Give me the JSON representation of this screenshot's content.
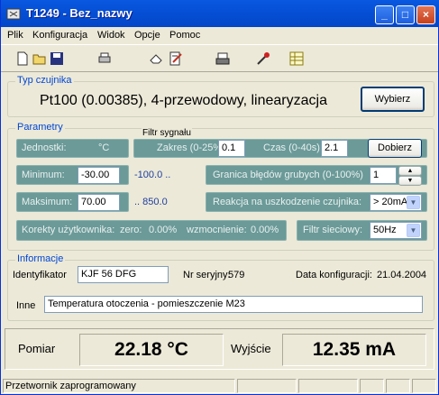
{
  "window": {
    "title": "T1249 - Bez_nazwy",
    "controls": [
      "minimize-icon",
      "maximize-icon",
      "close-icon"
    ]
  },
  "menu": [
    "Plik",
    "Konfiguracja",
    "Widok",
    "Opcje",
    "Pomoc"
  ],
  "toolbar": [
    "new-file-icon",
    "open-folder-icon",
    "save-icon",
    "print-icon",
    "eraser-icon",
    "edit-notes-icon",
    "printer-icon",
    "probe-icon",
    "spreadsheet-icon"
  ],
  "sensor": {
    "legend": "Typ czujnika",
    "value": "Pt100 (0.00385), 4-przewodowy, linearyzacja",
    "button": "Wybierz"
  },
  "params": {
    "legend": "Parametry",
    "filter_legend": "Filtr sygnału",
    "units_label": "Jednostki:",
    "units_value": "°C",
    "range_label": "Zakres (0-25%)",
    "range_value": "0.1",
    "time_label": "Czas (0-40s)",
    "time_value": "2.1",
    "choose_button": "Dobierz",
    "min_label": "Minimum:",
    "min_value": "-30.00",
    "min_range": "-100.0 ..",
    "max_label": "Maksimum:",
    "max_value": "70.00",
    "max_range": ".. 850.0",
    "gross_label": "Granica błędów grubych (0-100%)",
    "gross_value": "1",
    "fault_label": "Reakcja na uszkodzenie czujnika:",
    "fault_value": "> 20mA",
    "user_corr_label": "Korekty użytkownika:",
    "zero_label": "zero:",
    "zero_value": "0.00%",
    "gain_label": "wzmocnienie:",
    "gain_value": "0.00%",
    "mains_label": "Filtr sieciowy:",
    "mains_value": "50Hz"
  },
  "info": {
    "legend": "Informacje",
    "id_label": "Identyfikator",
    "id_value": "KJF 56 DFG",
    "serial_label": "Nr seryjny:",
    "serial_value": "579",
    "config_date_label": "Data konfiguracji:",
    "config_date_value": "21.04.2004",
    "other_label": "Inne",
    "other_value": "Temperatura otoczenia - pomieszczenie M23"
  },
  "readout": {
    "measure_label": "Pomiar",
    "measure_value": "22.18 °C",
    "output_label": "Wyjście",
    "output_value": "12.35 mA"
  },
  "status": {
    "text": "Przetwornik zaprogramowany"
  }
}
